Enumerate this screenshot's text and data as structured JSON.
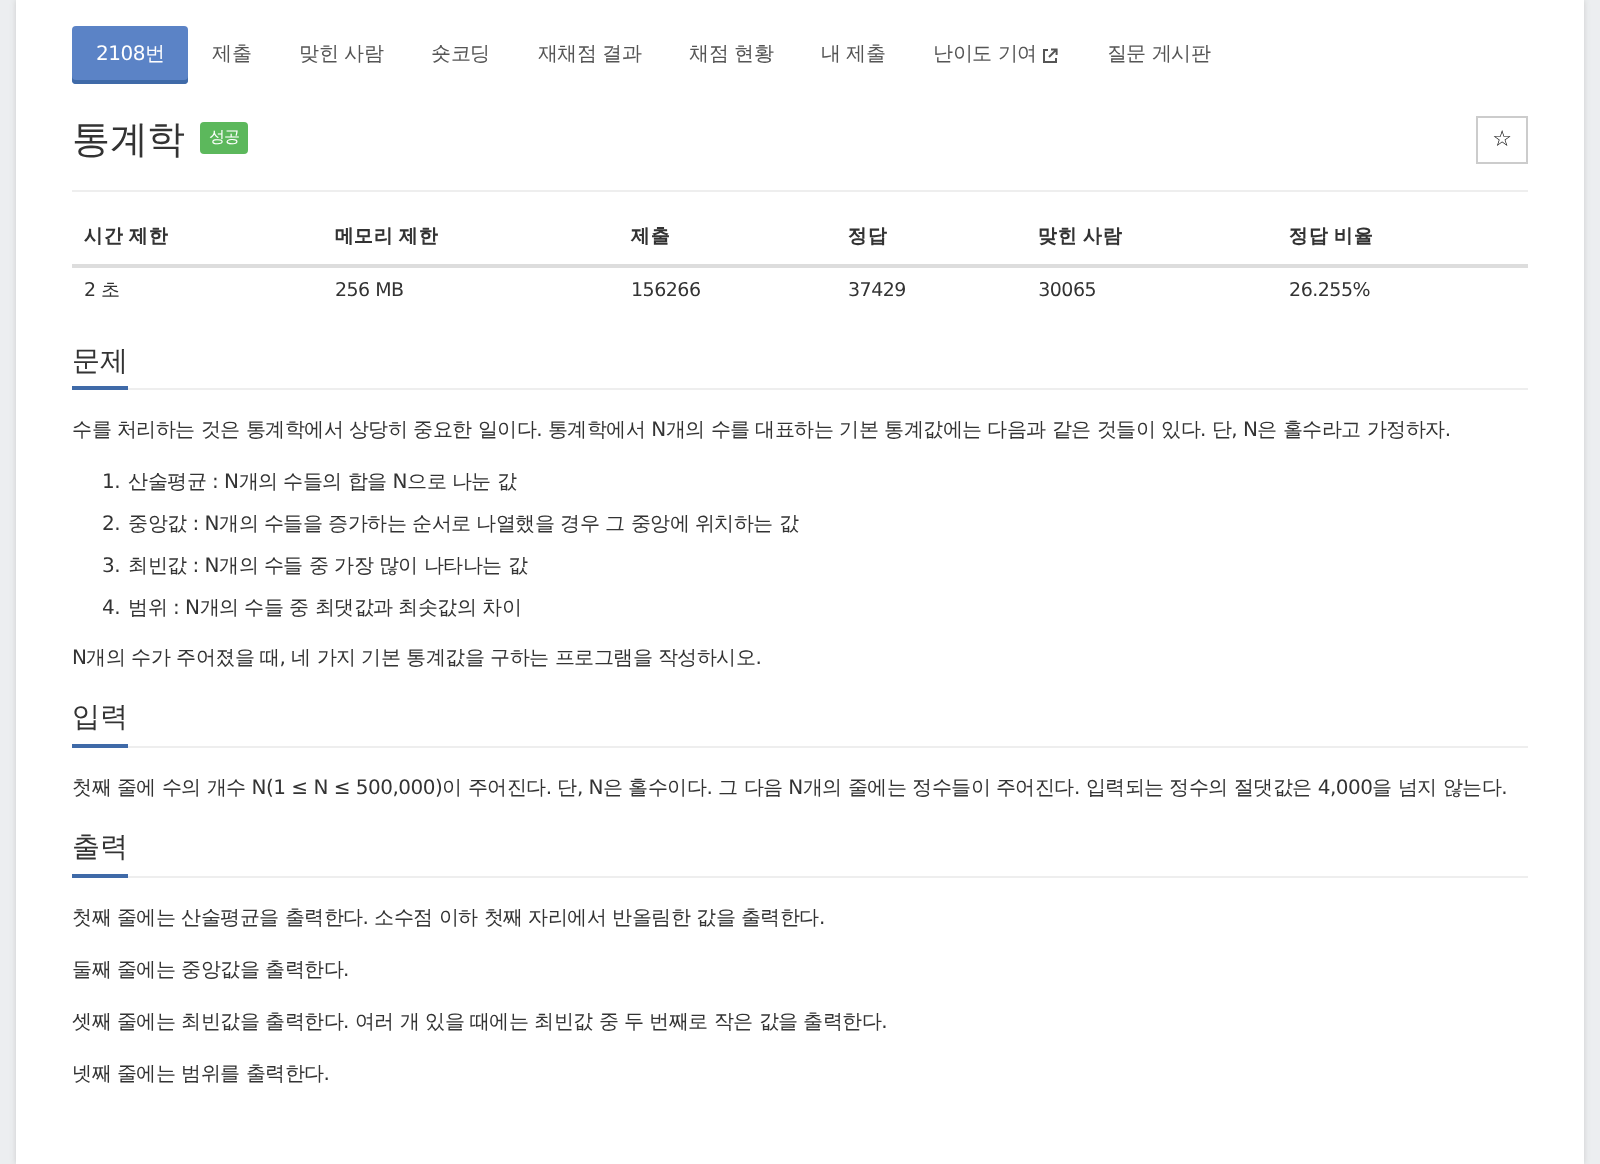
{
  "tabs": [
    {
      "label": "2108번",
      "selected": true
    },
    {
      "label": "제출",
      "selected": false
    },
    {
      "label": "맞힌 사람",
      "selected": false
    },
    {
      "label": "숏코딩",
      "selected": false
    },
    {
      "label": "재채점 결과",
      "selected": false
    },
    {
      "label": "채점 현황",
      "selected": false
    },
    {
      "label": "내 제출",
      "selected": false
    },
    {
      "label": "난이도 기여",
      "selected": false,
      "external": true
    },
    {
      "label": "질문 게시판",
      "selected": false
    }
  ],
  "title": "통계학",
  "status_badge": "성공",
  "star_button": "☆",
  "table": {
    "columns": [
      "시간 제한",
      "메모리 제한",
      "제출",
      "정답",
      "맞힌 사람",
      "정답 비율"
    ],
    "rows": [
      [
        "2 초",
        "256 MB",
        "156266",
        "37429",
        "30065",
        "26.255%"
      ]
    ]
  },
  "sections": [
    {
      "title": "문제",
      "content": [
        {
          "kind": "paragraph",
          "text": "수를 처리하는 것은 통계학에서 상당히 중요한 일이다. 통계학에서 N개의 수를 대표하는 기본 통계값에는 다음과 같은 것들이 있다. 단, N은 홀수라고 가정하자."
        },
        {
          "kind": "list",
          "items": [
            {
              "marker": "1.",
              "text": "산술평균 : N개의 수들의 합을 N으로 나눈 값"
            },
            {
              "marker": "2.",
              "text": "중앙값 : N개의 수들을 증가하는 순서로 나열했을 경우 그 중앙에 위치하는 값"
            },
            {
              "marker": "3.",
              "text": "최빈값 : N개의 수들 중 가장 많이 나타나는 값"
            },
            {
              "marker": "4.",
              "text": "범위 : N개의 수들 중 최댓값과 최솟값의 차이"
            }
          ]
        },
        {
          "kind": "paragraph",
          "text": "N개의 수가 주어졌을 때, 네 가지 기본 통계값을 구하는 프로그램을 작성하시오."
        }
      ]
    },
    {
      "title": "입력",
      "content": [
        {
          "kind": "paragraph",
          "text": "첫째 줄에 수의 개수 N(1 ≤ N ≤ 500,000)이 주어진다. 단, N은 홀수이다. 그 다음 N개의 줄에는 정수들이 주어진다. 입력되는 정수의 절댓값은 4,000을 넘지 않는다."
        }
      ]
    },
    {
      "title": "출력",
      "content": [
        {
          "kind": "paragraph",
          "text": "첫째 줄에는 산술평균을 출력한다. 소수점 이하 첫째 자리에서 반올림한 값을 출력한다."
        },
        {
          "kind": "paragraph",
          "text": "둘째 줄에는 중앙값을 출력한다."
        },
        {
          "kind": "paragraph",
          "text": "셋째 줄에는 최빈값을 출력한다. 여러 개 있을 때에는 최빈값 중 두 번째로 작은 값을 출력한다."
        },
        {
          "kind": "paragraph",
          "text": "넷째 줄에는 범위를 출력한다."
        }
      ]
    }
  ]
}
